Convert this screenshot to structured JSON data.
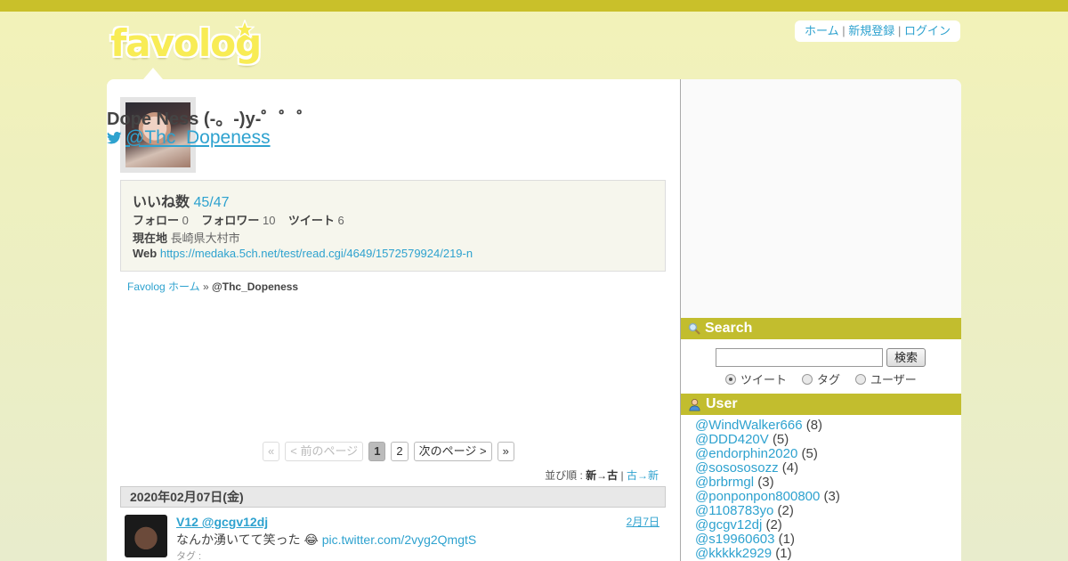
{
  "header": {
    "logo_text": "favolog",
    "nav": {
      "home": "ホーム",
      "register": "新規登録",
      "login": "ログイン",
      "separator": "|"
    }
  },
  "profile": {
    "name": "Dope Ness (-。-)y-゜゜゜",
    "handle": "@Thc_Dopeness",
    "likes_label": "いいね数",
    "likes_value": "45/47",
    "follow_label": "フォロー",
    "follow_value": "0",
    "follower_label": "フォロワー",
    "follower_value": "10",
    "tweet_label": "ツイート",
    "tweet_value": "6",
    "location_label": "現在地",
    "location_value": "長崎県大村市",
    "web_label": "Web",
    "web_value": "https://medaka.5ch.net/test/read.cgi/4649/1572579924/219-n"
  },
  "breadcrumb": {
    "home": "Favolog ホーム",
    "sep": "»",
    "current": "@Thc_Dopeness"
  },
  "pager": {
    "first": "«",
    "prev": "< 前のページ",
    "pages": [
      "1",
      "2"
    ],
    "next": "次のページ >",
    "last": "»"
  },
  "sort": {
    "label": "並び順 :",
    "newest": "新→古",
    "sep": "|",
    "oldest": "古→新"
  },
  "feed": {
    "date_header": "2020年02月07日(金)",
    "tweet": {
      "user": "V12 @gcgv12dj",
      "date": "2月7日",
      "text": "なんか湧いてて笑った",
      "emoji": "😂",
      "link": "pic.twitter.com/2vyg2QmgtS",
      "tag_label": "タグ :"
    }
  },
  "sidebar": {
    "search": {
      "title": "Search",
      "button": "検索",
      "options": [
        "ツイート",
        "タグ",
        "ユーザー"
      ],
      "selected": "ツイート"
    },
    "users": {
      "title": "User",
      "items": [
        {
          "name": "@WindWalker666",
          "count": "(8)"
        },
        {
          "name": "@DDD420V",
          "count": "(5)"
        },
        {
          "name": "@endorphin2020",
          "count": "(5)"
        },
        {
          "name": "@sosososozz",
          "count": "(4)"
        },
        {
          "name": "@brbrmgl",
          "count": "(3)"
        },
        {
          "name": "@ponponpon800800",
          "count": "(3)"
        },
        {
          "name": "@1108783yo",
          "count": "(2)"
        },
        {
          "name": "@gcgv12dj",
          "count": "(2)"
        },
        {
          "name": "@s19960603",
          "count": "(1)"
        },
        {
          "name": "@kkkkk2929",
          "count": "(1)"
        }
      ]
    }
  },
  "colors": {
    "topbar": "#c9c02a",
    "accent_link": "#2ea2cf",
    "section_header": "#c2bd2e",
    "logo": "#f8ec55"
  },
  "icons": {
    "twitter": "twitter-bird-icon",
    "search": "magnifier-icon",
    "user": "user-icon",
    "logo_star": "star-icon"
  }
}
